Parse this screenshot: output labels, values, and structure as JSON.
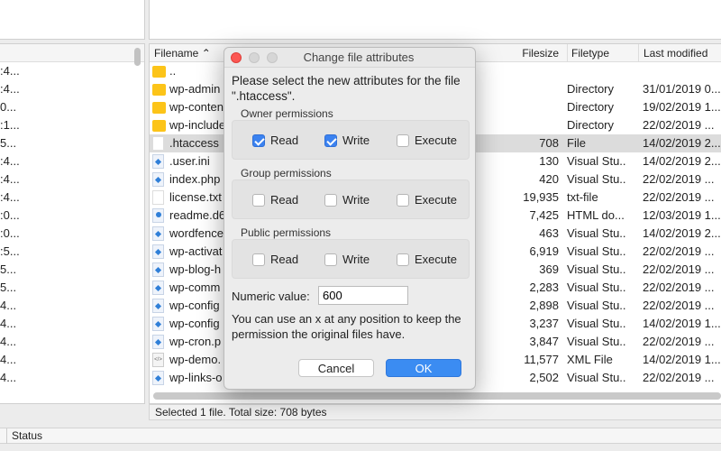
{
  "left_pane": {
    "rows": [
      ":4...",
      ":4...",
      "0...",
      ":1...",
      "5...",
      ":4...",
      ":4...",
      ":4...",
      ":0...",
      ":0...",
      ":5...",
      "5...",
      "5...",
      "4...",
      "4...",
      "4...",
      "4...",
      "4..."
    ]
  },
  "right_pane": {
    "columns": {
      "filename": "Filename",
      "filesize": "Filesize",
      "filetype": "Filetype",
      "last_modified": "Last modified"
    },
    "rows": [
      {
        "icon": "folder",
        "name": "..",
        "size": "",
        "type": "",
        "mod": ""
      },
      {
        "icon": "folder",
        "name": "wp-admin",
        "size": "",
        "type": "Directory",
        "mod": "31/01/2019 0..."
      },
      {
        "icon": "folder",
        "name": "wp-content",
        "size": "",
        "type": "Directory",
        "mod": "19/02/2019 1..."
      },
      {
        "icon": "folder",
        "name": "wp-includes",
        "size": "",
        "type": "Directory",
        "mod": "22/02/2019 ..."
      },
      {
        "icon": "doc",
        "name": ".htaccess",
        "size": "708",
        "type": "File",
        "mod": "14/02/2019 2...",
        "selected": true
      },
      {
        "icon": "vs",
        "name": ".user.ini",
        "size": "130",
        "type": "Visual Stu..",
        "mod": "14/02/2019 2..."
      },
      {
        "icon": "vs",
        "name": "index.php",
        "size": "420",
        "type": "Visual Stu..",
        "mod": "22/02/2019 ..."
      },
      {
        "icon": "doc",
        "name": "license.txt",
        "size": "19,935",
        "type": "txt-file",
        "mod": "22/02/2019 ..."
      },
      {
        "icon": "html",
        "name": "readme.d6",
        "size": "7,425",
        "type": "HTML do...",
        "mod": "12/03/2019 1..."
      },
      {
        "icon": "vs",
        "name": "wordfence",
        "size": "463",
        "type": "Visual Stu..",
        "mod": "14/02/2019 2..."
      },
      {
        "icon": "vs",
        "name": "wp-activat",
        "size": "6,919",
        "type": "Visual Stu..",
        "mod": "22/02/2019 ..."
      },
      {
        "icon": "vs",
        "name": "wp-blog-h",
        "size": "369",
        "type": "Visual Stu..",
        "mod": "22/02/2019 ..."
      },
      {
        "icon": "vs",
        "name": "wp-comm",
        "size": "2,283",
        "type": "Visual Stu..",
        "mod": "22/02/2019 ..."
      },
      {
        "icon": "vs",
        "name": "wp-config",
        "size": "2,898",
        "type": "Visual Stu..",
        "mod": "22/02/2019 ..."
      },
      {
        "icon": "vs",
        "name": "wp-config",
        "size": "3,237",
        "type": "Visual Stu..",
        "mod": "14/02/2019 1..."
      },
      {
        "icon": "vs",
        "name": "wp-cron.p",
        "size": "3,847",
        "type": "Visual Stu..",
        "mod": "22/02/2019 ..."
      },
      {
        "icon": "xml",
        "name": "wp-demo.",
        "size": "11,577",
        "type": "XML File",
        "mod": "14/02/2019 1..."
      },
      {
        "icon": "vs",
        "name": "wp-links-o",
        "size": "2,502",
        "type": "Visual Stu..",
        "mod": "22/02/2019 ..."
      }
    ],
    "status": "Selected 1 file. Total size: 708 bytes"
  },
  "bottom": {
    "status_label": "Status"
  },
  "dialog": {
    "title": "Change file attributes",
    "prompt": "Please select the new attributes for the file \".htaccess\".",
    "groups": [
      {
        "label": "Owner permissions",
        "read": true,
        "write": true,
        "execute": false
      },
      {
        "label": "Group permissions",
        "read": false,
        "write": false,
        "execute": false
      },
      {
        "label": "Public permissions",
        "read": false,
        "write": false,
        "execute": false
      }
    ],
    "labels": {
      "read": "Read",
      "write": "Write",
      "execute": "Execute"
    },
    "numeric_label": "Numeric value:",
    "numeric_value": "600",
    "hint": "You can use an x at any position to keep the permission the original files have.",
    "cancel": "Cancel",
    "ok": "OK",
    "accent": "#3b82f0"
  }
}
